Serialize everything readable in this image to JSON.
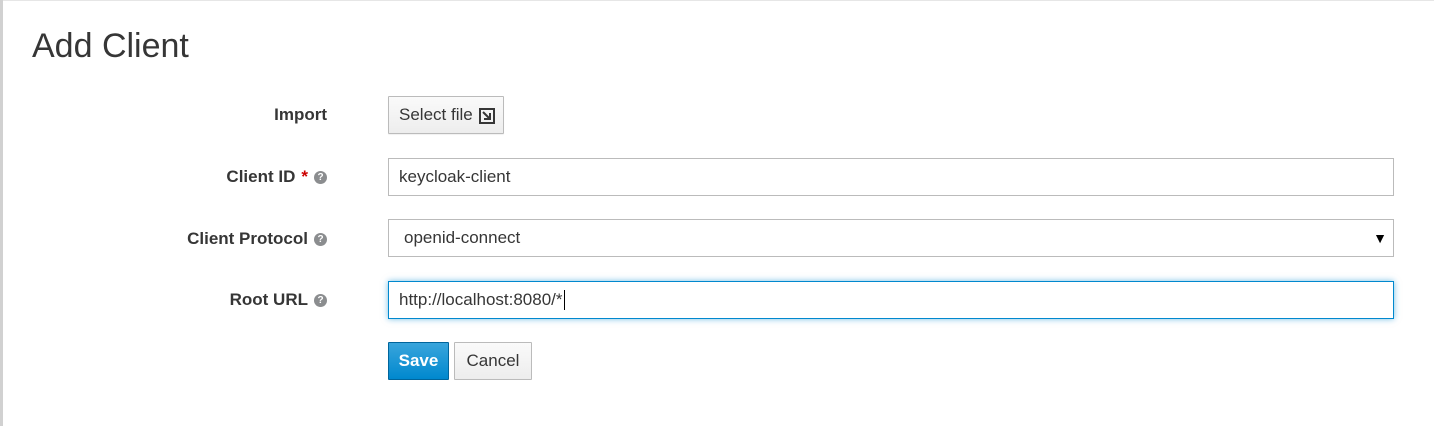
{
  "page": {
    "title": "Add Client"
  },
  "form": {
    "import": {
      "label": "Import",
      "button_label": "Select file",
      "icon": "import-icon"
    },
    "client_id": {
      "label": "Client ID",
      "required_marker": "*",
      "help_icon": "?",
      "value": "keycloak-client"
    },
    "client_protocol": {
      "label": "Client Protocol",
      "help_icon": "?",
      "selected": "openid-connect",
      "arrow": "▼"
    },
    "root_url": {
      "label": "Root URL",
      "help_icon": "?",
      "value": "http://localhost:8080/*"
    }
  },
  "actions": {
    "save_label": "Save",
    "cancel_label": "Cancel"
  },
  "colors": {
    "primary": "#0088ce",
    "required": "#cc0000",
    "text": "#363636"
  }
}
